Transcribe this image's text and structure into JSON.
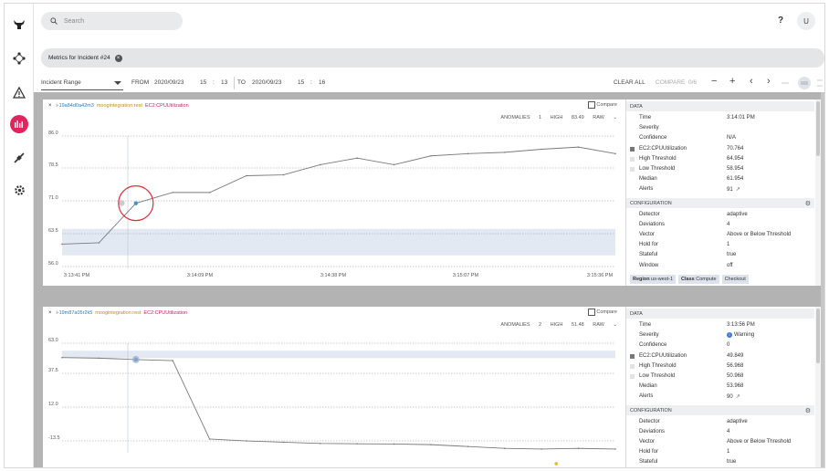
{
  "search": {
    "placeholder": "Search"
  },
  "header": {
    "help": "?",
    "user_initial": "U"
  },
  "rail": {
    "icons": [
      "bull-logo-icon",
      "workflow-icon",
      "alert-triangle-icon",
      "metrics-icon",
      "integrations-icon",
      "settings-icon"
    ],
    "active": "metrics-icon",
    "accent": "#e0245e"
  },
  "page": {
    "title": "Metrics for Incident #24"
  },
  "controls": {
    "range_label": "Incident Range",
    "from_label": "FROM",
    "from_date": "2020/09/23",
    "from_hour": "15",
    "from_sep": ":",
    "from_min": "13",
    "to_label": "TO",
    "to_date": "2020/09/23",
    "to_hour": "15",
    "to_sep": ":",
    "to_min": "16",
    "clear_all": "CLEAR ALL",
    "compare": "COMPARE",
    "compare_count": "0/6",
    "minus": "−",
    "plus": "+",
    "prev": "‹",
    "next": "›"
  },
  "panels": [
    {
      "close": "×",
      "instance": "i-19a84d0a42m3",
      "source": "moogintegration:rest",
      "metric": "EC2:CPUUtilization",
      "compare_label": "Compare",
      "anomalies_label": "ANOMALIES",
      "anomalies": "1",
      "high_label": "HIGH",
      "high": "83.49",
      "mode": "RAW",
      "chart_data": {
        "type": "line",
        "x": [
          "15:13:41",
          "15:13:56",
          "15:14:01",
          "15:14:11",
          "15:14:21",
          "15:14:31",
          "15:14:41",
          "15:14:51",
          "15:15:01",
          "15:15:11",
          "15:15:21",
          "15:15:31",
          "15:15:41",
          "15:15:51",
          "15:16:01",
          "15:16:11"
        ],
        "y": [
          61.5,
          61.8,
          70.764,
          73.2,
          73.2,
          77.0,
          77.2,
          79.5,
          81.0,
          79.5,
          81.5,
          82.0,
          82.3,
          83.0,
          83.49,
          82.0
        ],
        "ylim": [
          56.0,
          86.0
        ],
        "ytick_labels": [
          "86.0",
          "78.5",
          "71.0",
          "63.5",
          "56.0"
        ],
        "xtick_labels": [
          "3:13:41 PM",
          "3:14:09 PM",
          "3:14:38 PM",
          "3:15:07 PM",
          "3:15:36 PM"
        ],
        "band": [
          58.954,
          64.954
        ],
        "anomaly_index": 2,
        "grid": true
      },
      "data_label": "DATA",
      "data": [
        {
          "k": "Time",
          "v": "3:14:01 PM"
        },
        {
          "k": "Severity",
          "v": ""
        },
        {
          "k": "Confidence",
          "v": "N/A"
        },
        {
          "k": "EC2:CPUUtilization",
          "v": "70.764",
          "swatch": "#777777"
        },
        {
          "k": "High Threshold",
          "v": "64.954",
          "swatch": "#e3e3e3"
        },
        {
          "k": "Low Threshold",
          "v": "58.954",
          "swatch": "#e3e3e3"
        },
        {
          "k": "Median",
          "v": "61.954"
        },
        {
          "k": "Alerts",
          "v": "91",
          "ext": "↗"
        }
      ],
      "config_label": "CONFIGURATION",
      "config": [
        {
          "k": "Detector",
          "v": "adaptive"
        },
        {
          "k": "Deviations",
          "v": "4"
        },
        {
          "k": "Vector",
          "v": "Above or Below Threshold"
        },
        {
          "k": "Hold for",
          "v": "1"
        },
        {
          "k": "Stateful",
          "v": "true"
        },
        {
          "k": "Window",
          "v": "off"
        }
      ],
      "tags": [
        {
          "k": "Region",
          "v": "us-west-1"
        },
        {
          "k": "Class",
          "v": "Compute"
        },
        {
          "k": "",
          "v": "Checkout"
        }
      ]
    },
    {
      "close": "×",
      "instance": "i-19m87a05r2k5",
      "source": "moogintegration:rest",
      "metric": "EC2:CPUUtilization",
      "compare_label": "Compare",
      "anomalies_label": "ANOMALIES",
      "anomalies": "2",
      "high_label": "HIGH",
      "high": "51.48",
      "mode": "RAW",
      "chart_data": {
        "type": "line",
        "x": [
          "15:13:41",
          "15:13:56",
          "15:14:01",
          "15:14:11",
          "15:14:21",
          "15:14:31",
          "15:14:41",
          "15:14:51",
          "15:15:01",
          "15:15:11",
          "15:15:21",
          "15:15:31",
          "15:15:41",
          "15:15:51",
          "15:16:01",
          "15:16:11"
        ],
        "y": [
          51.48,
          51.0,
          49.849,
          49.0,
          -14.0,
          -15.5,
          -16.5,
          -17.5,
          -17.8,
          -18.0,
          -18.5,
          -20.0,
          -21.5,
          -22.0,
          -21.5,
          -22.0
        ],
        "ylim": [
          -25.0,
          63.0
        ],
        "ytick_labels": [
          "63.0",
          "37.5",
          "12.0",
          "-13.5"
        ],
        "band": [
          50.968,
          56.968
        ],
        "anomaly_index": 2,
        "grid": true
      },
      "data_label": "DATA",
      "data": [
        {
          "k": "Time",
          "v": "3:13:56 PM"
        },
        {
          "k": "Severity",
          "v": "Warning",
          "icon": "info-icon"
        },
        {
          "k": "Confidence",
          "v": "0"
        },
        {
          "k": "EC2:CPUUtilization",
          "v": "49.849",
          "swatch": "#777777"
        },
        {
          "k": "High Threshold",
          "v": "56.968",
          "swatch": "#e3e3e3"
        },
        {
          "k": "Low Threshold",
          "v": "50.968",
          "swatch": "#e3e3e3"
        },
        {
          "k": "Median",
          "v": "53.968"
        },
        {
          "k": "Alerts",
          "v": "90",
          "ext": "↗"
        }
      ],
      "config_label": "CONFIGURATION",
      "config": [
        {
          "k": "Detector",
          "v": "adaptive"
        },
        {
          "k": "Deviations",
          "v": "4"
        },
        {
          "k": "Vector",
          "v": "Above or Below Threshold"
        },
        {
          "k": "Hold for",
          "v": "1"
        },
        {
          "k": "Stateful",
          "v": "true"
        }
      ]
    }
  ]
}
